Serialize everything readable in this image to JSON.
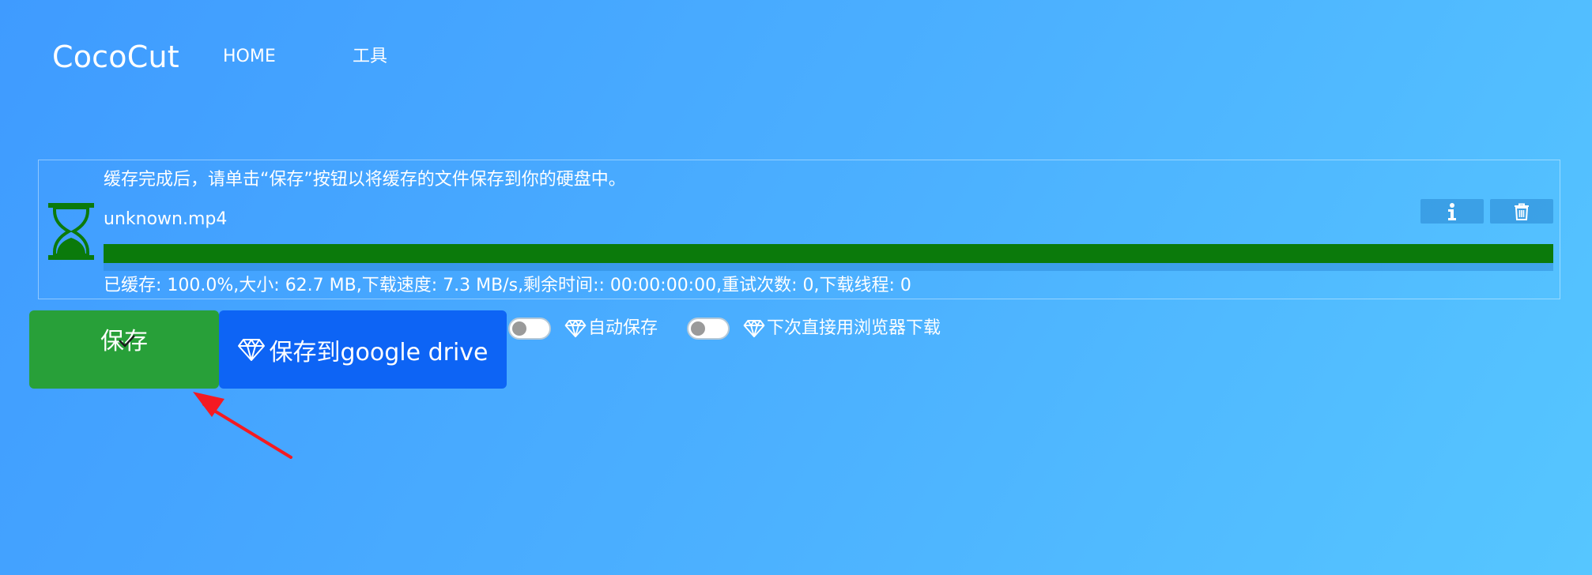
{
  "header": {
    "brand": "CocoCut",
    "nav": [
      {
        "label": "HOME"
      },
      {
        "label": "工具"
      }
    ]
  },
  "download": {
    "message": "缓存完成后，请单击“保存”按钮以将缓存的文件保存到你的硬盘中。",
    "filename": "unknown.mp4",
    "progress_percent": 100.0,
    "stats": "已缓存: 100.0%,大小: 62.7 MB,下载速度: 7.3 MB/s,剩余时间:: 00:00:00:00,重试次数: 0,下载线程: 0",
    "status_icon": "hourglass-icon",
    "progress_color": "#0b7a0b"
  },
  "actions": {
    "save_label": "保存",
    "save_color": "#28a039",
    "gdrive_label": "保存到google drive",
    "gdrive_color": "#0d64f5",
    "auto_save_label": "自动保存",
    "auto_save_on": false,
    "browser_download_label": "下次直接用浏览器下载",
    "browser_download_on": false
  },
  "annotation": {
    "arrow_color": "#f41a22"
  }
}
